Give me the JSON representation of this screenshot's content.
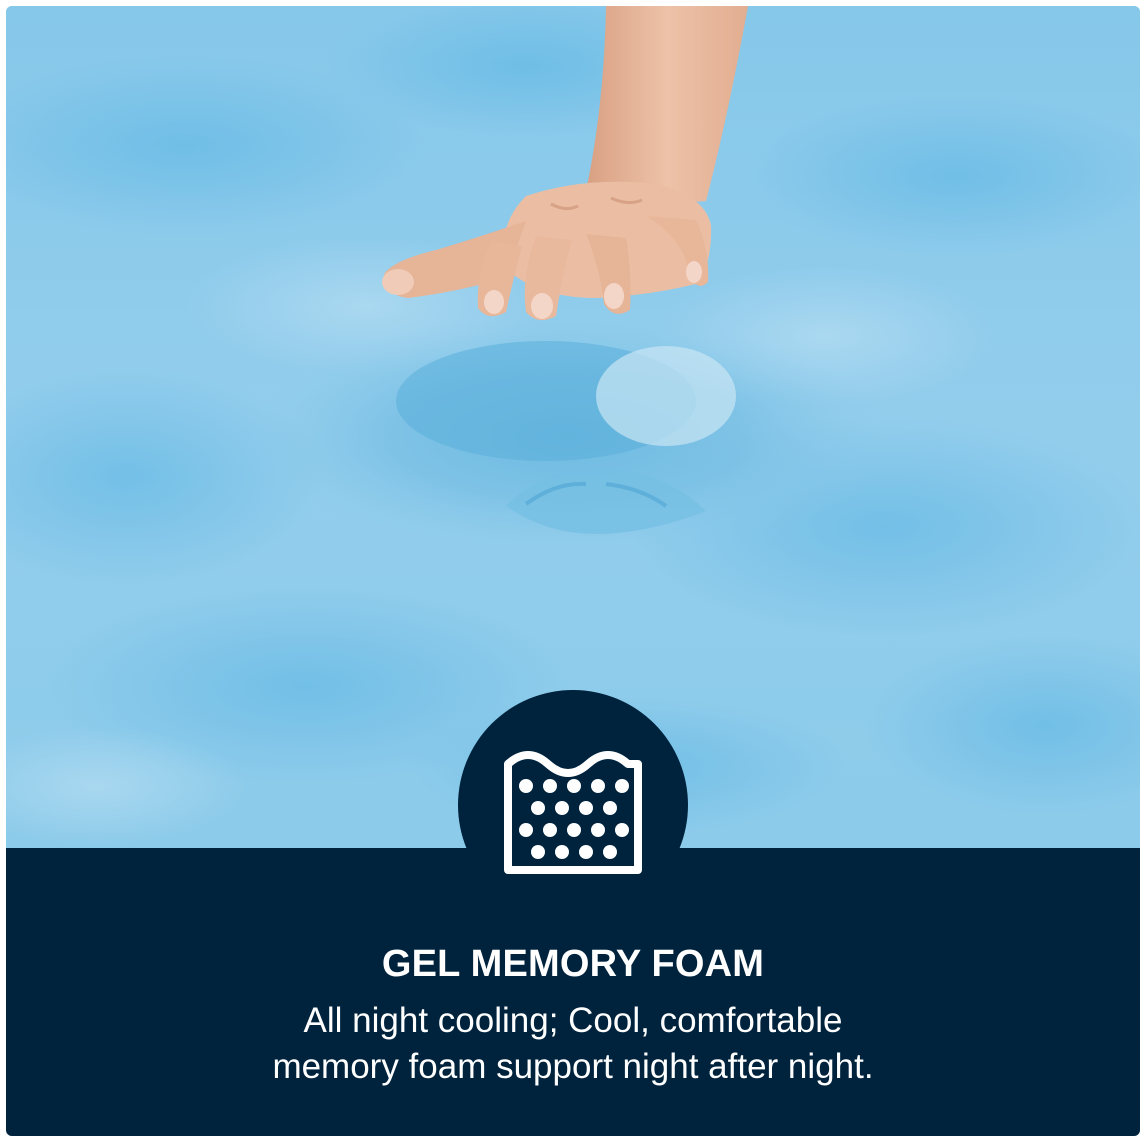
{
  "feature": {
    "icon": "gel-foam-cells-icon",
    "title": "GEL MEMORY FOAM",
    "description_lines": [
      "All night cooling; Cool, comfortable",
      "memory foam support night after night."
    ]
  },
  "colors": {
    "foam_blue": "#8fcbea",
    "foam_deep_blue": "#56b4e2",
    "panel_navy": "#00233d",
    "text_white": "#ffffff",
    "skin": "#e9b99e"
  }
}
